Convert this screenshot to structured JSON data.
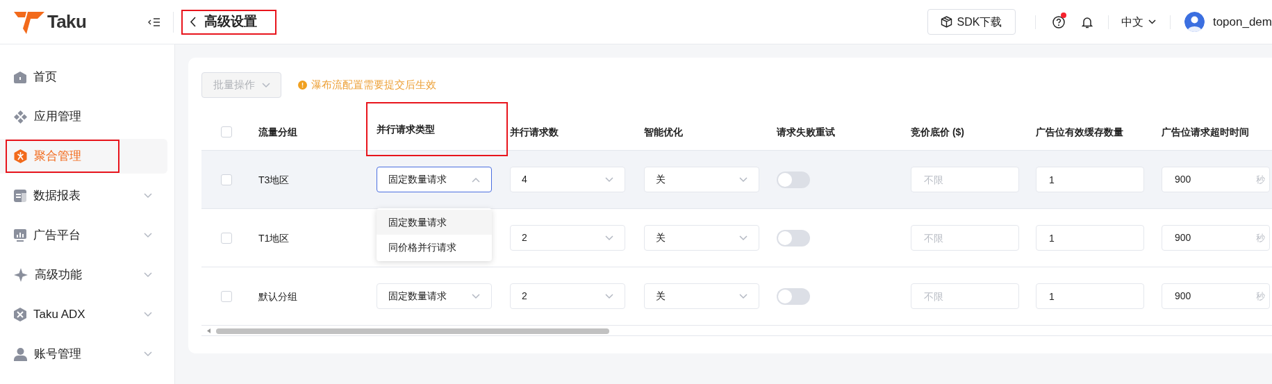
{
  "header": {
    "logo": "Taku",
    "title": "高级设置",
    "title_highlighted": true,
    "sdk_button": "SDK下载",
    "help_badge": true,
    "language": "中文",
    "username": "topon_dem"
  },
  "sidebar": {
    "items": [
      {
        "label": "首页",
        "selected": false,
        "expandable": false,
        "highlighted": false
      },
      {
        "label": "应用管理",
        "selected": false,
        "expandable": false,
        "highlighted": false
      },
      {
        "label": "聚合管理",
        "selected": true,
        "expandable": false,
        "highlighted": true
      },
      {
        "label": "数据报表",
        "selected": false,
        "expandable": true,
        "highlighted": false
      },
      {
        "label": "广告平台",
        "selected": false,
        "expandable": true,
        "highlighted": false
      },
      {
        "label": "高级功能",
        "selected": false,
        "expandable": true,
        "highlighted": false
      },
      {
        "label": "Taku ADX",
        "selected": false,
        "expandable": true,
        "highlighted": false
      },
      {
        "label": "账号管理",
        "selected": false,
        "expandable": true,
        "highlighted": false
      }
    ]
  },
  "toolbar": {
    "batch_button": {
      "label": "批量操作",
      "disabled": true
    },
    "notice": "瀑布流配置需要提交后生效"
  },
  "table": {
    "header_checked": false,
    "columns": [
      {
        "label": "流量分组",
        "highlighted": false
      },
      {
        "label": "并行请求类型",
        "highlighted": true
      },
      {
        "label": "并行请求数",
        "highlighted": false
      },
      {
        "label": "智能优化",
        "highlighted": false
      },
      {
        "label": "请求失败重试",
        "highlighted": false
      },
      {
        "label": "竞价底价 ($)",
        "highlighted": false
      },
      {
        "label": "广告位有效缓存数量",
        "highlighted": false
      },
      {
        "label": "广告位请求超时时间",
        "highlighted": false
      }
    ],
    "rows": [
      {
        "checked": false,
        "hovered": true,
        "group": "T3地区",
        "type": {
          "value": "固定数量请求",
          "open": true,
          "options": [
            {
              "label": "固定数量请求",
              "selected": true
            },
            {
              "label": "同价格并行请求",
              "selected": false
            }
          ]
        },
        "count": "4",
        "smart": "关",
        "retry_on": false,
        "floor_placeholder": "不限",
        "cache": "1",
        "timeout": "900",
        "timeout_unit": "秒"
      },
      {
        "checked": false,
        "hovered": false,
        "group": "T1地区",
        "count": "2",
        "smart": "关",
        "retry_on": false,
        "floor_placeholder": "不限",
        "cache": "1",
        "timeout": "900",
        "timeout_unit": "秒"
      },
      {
        "checked": false,
        "hovered": false,
        "group": "默认分组",
        "type": {
          "value": "固定数量请求",
          "open": false
        },
        "count": "2",
        "smart": "关",
        "retry_on": false,
        "floor_placeholder": "不限",
        "cache": "1",
        "timeout": "900",
        "timeout_unit": "秒"
      }
    ]
  }
}
